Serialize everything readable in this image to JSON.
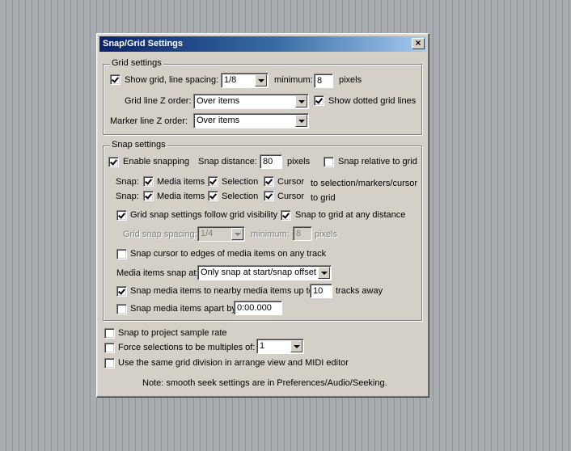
{
  "dialog": {
    "title": "Snap/Grid Settings",
    "close_glyph": "×"
  },
  "grid_settings": {
    "legend": "Grid settings",
    "show_grid": {
      "label": "Show grid, line spacing:",
      "checked": true
    },
    "line_spacing_value": "1/8",
    "minimum_label": "minimum:",
    "minimum_value": "8",
    "pixels_label": "pixels",
    "grid_z_label": "Grid line Z order:",
    "grid_z_value": "Over items",
    "show_dotted": {
      "label": "Show dotted grid lines",
      "checked": true
    },
    "marker_z_label": "Marker line Z order:",
    "marker_z_value": "Over items"
  },
  "snap_settings": {
    "legend": "Snap settings",
    "enable_snapping": {
      "label": "Enable snapping",
      "checked": true
    },
    "snap_distance_label": "Snap distance:",
    "snap_distance_value": "80",
    "pixels_label": "pixels",
    "snap_relative": {
      "label": "Snap relative to grid",
      "checked": false
    },
    "row1": {
      "prefix": "Snap:",
      "media": "Media items",
      "selection": "Selection",
      "cursor": "Cursor",
      "suffix": "to selection/markers/cursor"
    },
    "row2": {
      "prefix": "Snap:",
      "media": "Media items",
      "selection": "Selection",
      "cursor": "Cursor",
      "suffix": "to grid"
    },
    "follow_visibility": {
      "label": "Grid snap settings follow grid visibility",
      "checked": true
    },
    "any_distance": {
      "label": "Snap to grid at any distance",
      "checked": true
    },
    "spacing_label": "Grid snap spacing:",
    "spacing_value": "1/4",
    "min_label": "minimum:",
    "min_value": "8",
    "min_pixels": "pixels",
    "cursor_edges": {
      "label": "Snap cursor to edges of media items on any track",
      "checked": false
    },
    "media_snap_label": "Media items snap at:",
    "media_snap_value": "Only snap at start/snap offset",
    "nearby": {
      "label": "Snap media items to nearby media items up to:",
      "checked": true
    },
    "nearby_value": "10",
    "tracks_away": "tracks away",
    "apart": {
      "label": "Snap media items apart by:",
      "checked": false
    },
    "apart_value": "0:00.000"
  },
  "bottom": {
    "sample_rate": {
      "label": "Snap to project sample rate",
      "checked": false
    },
    "force_multiples": {
      "label": "Force selections to be multiples of:",
      "checked": false
    },
    "multiples_value": "1",
    "same_grid": {
      "label": "Use the same grid division in arrange view and MIDI editor",
      "checked": false
    },
    "note": "Note: smooth seek settings are in Preferences/Audio/Seeking."
  }
}
